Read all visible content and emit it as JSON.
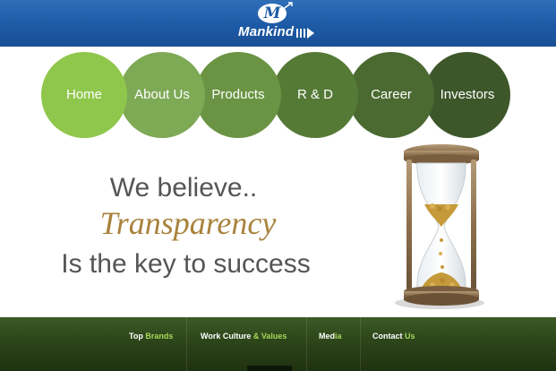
{
  "header": {
    "brand": "Mankind",
    "logo_letter": "M"
  },
  "nav": {
    "items": [
      {
        "label": "Home"
      },
      {
        "label": "About Us"
      },
      {
        "label": "Products"
      },
      {
        "label": "R & D"
      },
      {
        "label": "Career"
      },
      {
        "label": "Investors"
      }
    ]
  },
  "hero": {
    "line1": "We believe..",
    "line2": "Transparency",
    "line3": "Is the key to success"
  },
  "footer": {
    "links": [
      {
        "first": "Top ",
        "accent": "Brands"
      },
      {
        "first": "Work Culture ",
        "accent": "& Values"
      },
      {
        "first": "Med",
        "accent": "ia"
      },
      {
        "first": "Contact ",
        "accent": "Us"
      }
    ]
  },
  "colors": {
    "header_blue": "#1d5aa6",
    "nav_greens": [
      "#8fc74c",
      "#7ea955",
      "#6a9443",
      "#557a36",
      "#4a6a31",
      "#3d572a"
    ],
    "tagline_gold": "#a8823c",
    "footer_accent": "#a5d65a"
  },
  "icons": {
    "logo": "mankind-logo-icon",
    "hero_image": "hourglass-icon"
  }
}
